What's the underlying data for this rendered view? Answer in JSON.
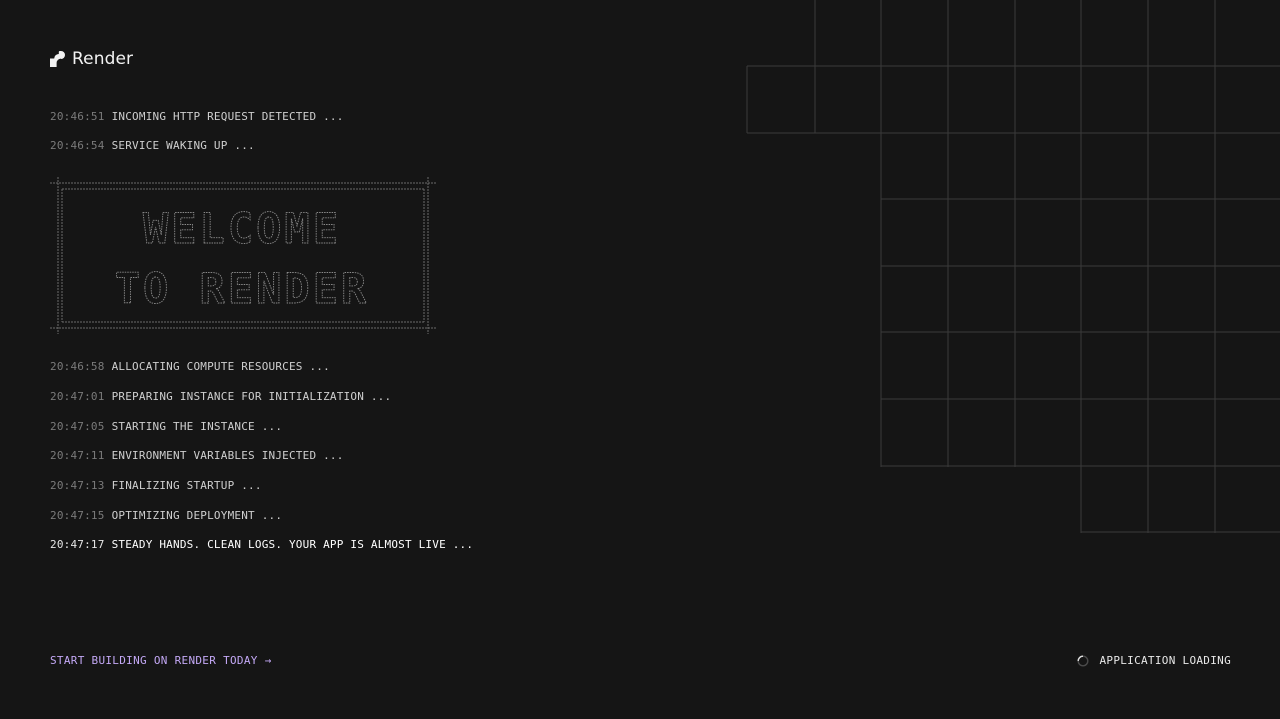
{
  "brand": {
    "name": "Render",
    "logo_icon": "render-logo-icon",
    "text_color": "#f2f2f2"
  },
  "logs_before_banner": [
    {
      "time": "20:46:51",
      "message": "INCOMING HTTP REQUEST DETECTED ..."
    },
    {
      "time": "20:46:54",
      "message": "SERVICE WAKING UP ..."
    }
  ],
  "banner": {
    "lines": [
      "WELCOME",
      "TO RENDER"
    ],
    "style": "ascii-art outline",
    "color": "#8a8a8a"
  },
  "logs_after_banner": [
    {
      "time": "20:46:58",
      "message": "ALLOCATING COMPUTE RESOURCES ..."
    },
    {
      "time": "20:47:01",
      "message": "PREPARING INSTANCE FOR INITIALIZATION ..."
    },
    {
      "time": "20:47:05",
      "message": "STARTING THE INSTANCE ..."
    },
    {
      "time": "20:47:11",
      "message": "ENVIRONMENT VARIABLES INJECTED ..."
    },
    {
      "time": "20:47:13",
      "message": "FINALIZING STARTUP ..."
    },
    {
      "time": "20:47:15",
      "message": "OPTIMIZING DEPLOYMENT ..."
    },
    {
      "time": "20:47:17",
      "message": "STEADY HANDS. CLEAN LOGS. YOUR APP IS ALMOST LIVE ..."
    }
  ],
  "footer": {
    "cta_label": "START BUILDING ON RENDER TODAY →",
    "status_label": "APPLICATION LOADING",
    "status_icon": "loading-spinner-icon"
  },
  "colors": {
    "background": "#151515",
    "accent": "#c3a8f5",
    "timestamp": "#7a7a7a",
    "message": "#cfcfcf",
    "grid_line": "#3a3a3a"
  }
}
